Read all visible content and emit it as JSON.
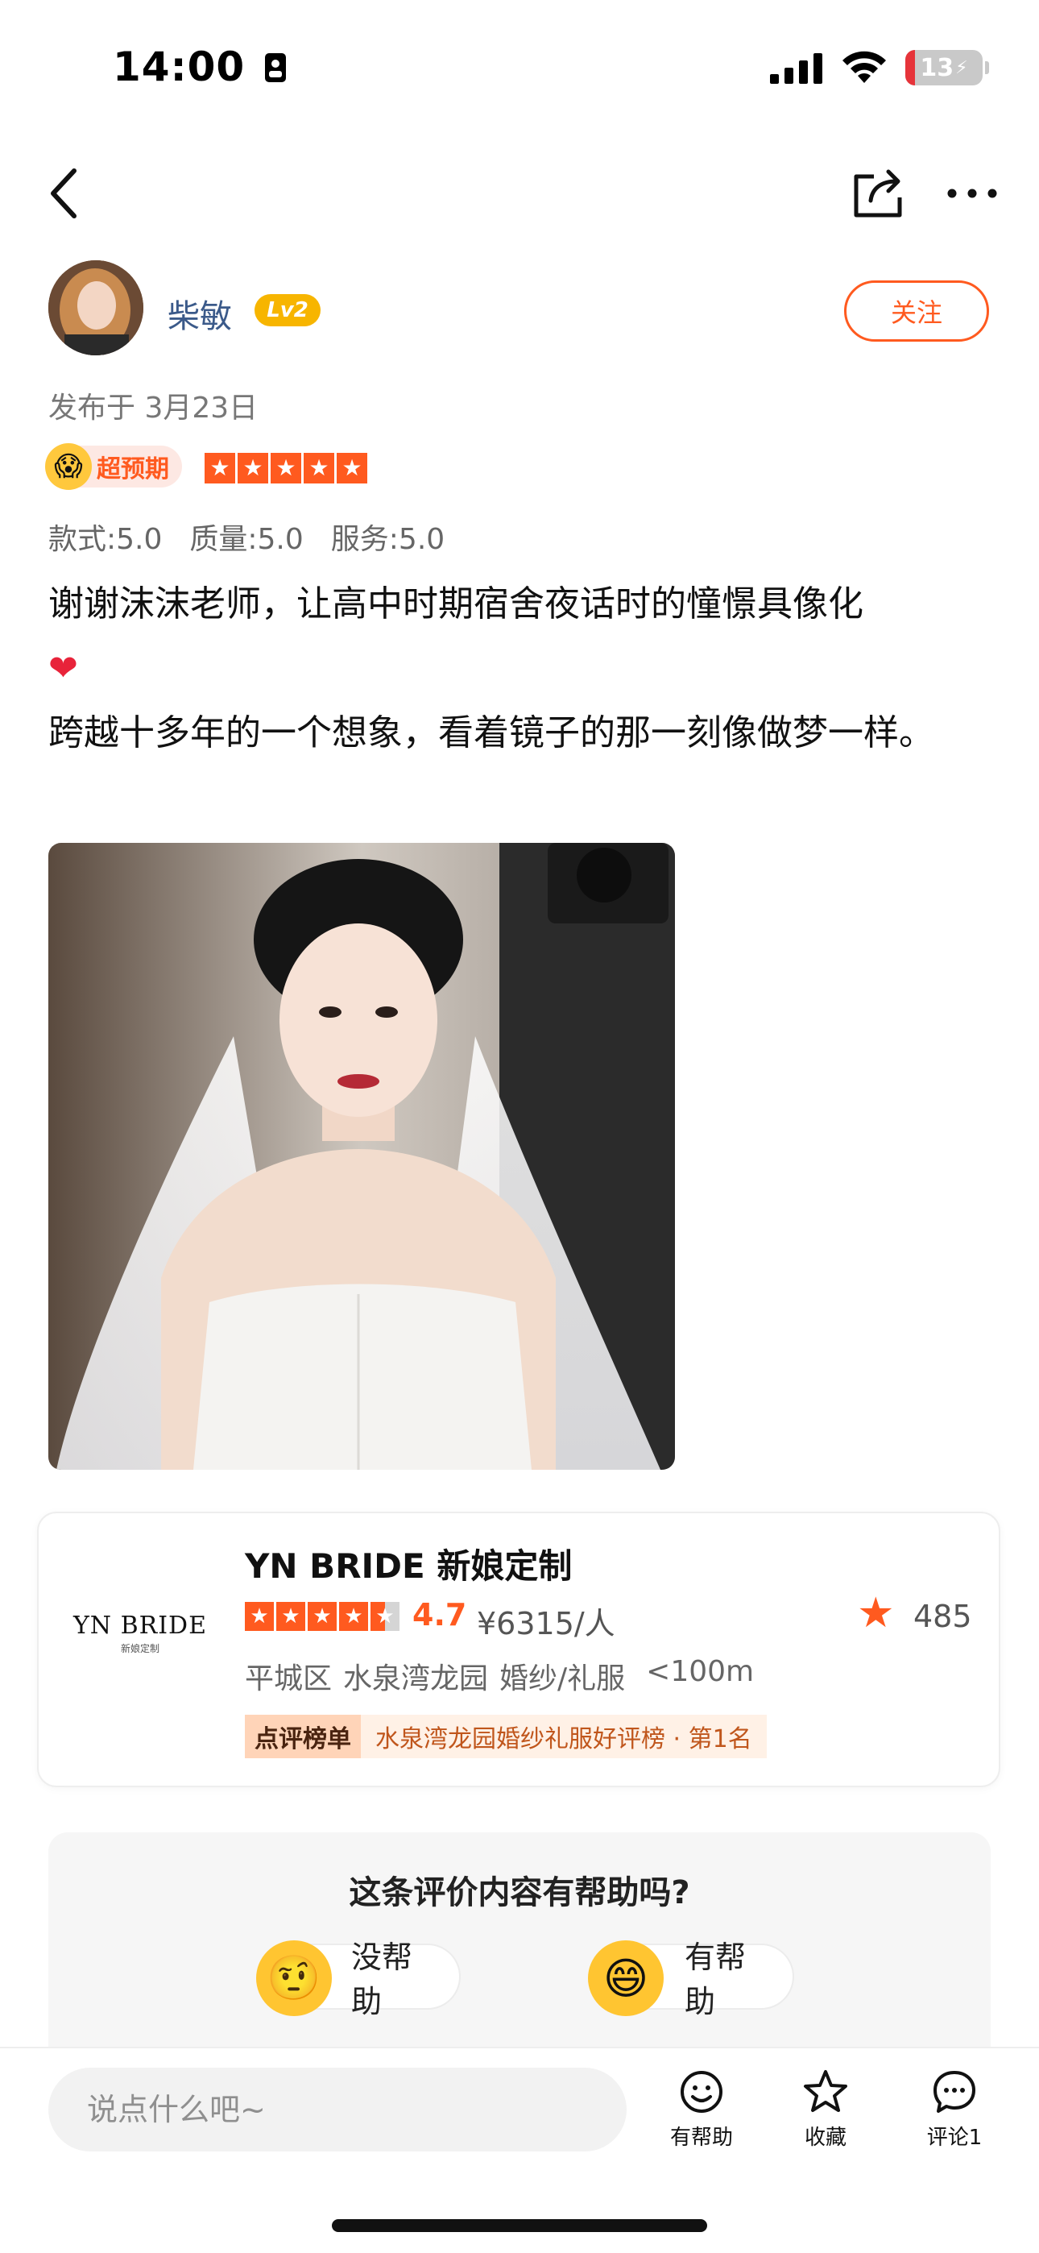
{
  "status_bar": {
    "time": "14:00",
    "battery": "13"
  },
  "header": {
    "back_icon": "chevron-left-icon",
    "share_icon": "share-icon",
    "more_icon": "more-icon"
  },
  "author": {
    "name": "柴敏",
    "level": "Lv2",
    "follow_label": "关注"
  },
  "review": {
    "publish_date": "发布于 3月23日",
    "exceed_label": "超预期",
    "rating_stars": 5,
    "scores": [
      "款式:5.0",
      "质量:5.0",
      "服务:5.0"
    ],
    "line1": "谢谢沫沫老师，让高中时期宿舍夜话时的憧憬具像化",
    "line2": "跨越十多年的一个想象，看着镜子的那一刻像做梦一样。"
  },
  "shop": {
    "logo_main": "YN BRIDE",
    "logo_sub": "新娘定制",
    "name": "YN BRIDE 新娘定制",
    "stars": 4.5,
    "rating": "4.7",
    "price": "¥6315/人",
    "favorites": "485",
    "district": "平城区",
    "area": "水泉湾龙园",
    "category": "婚纱/礼服",
    "distance": "<100m",
    "rank_label": "点评榜单",
    "rank_text": "水泉湾龙园婚纱礼服好评榜 · 第1名"
  },
  "helpful_panel": {
    "question": "这条评价内容有帮助吗?",
    "not_helpful": "没帮助",
    "helpful": "有帮助"
  },
  "bottom_bar": {
    "comment_placeholder": "说点什么吧~",
    "helpful_label": "有帮助",
    "collect_label": "收藏",
    "comment_label": "评论1"
  },
  "colors": {
    "accent": "#ff5a1f",
    "level": "#f7b500",
    "username": "#3b5a8a"
  }
}
